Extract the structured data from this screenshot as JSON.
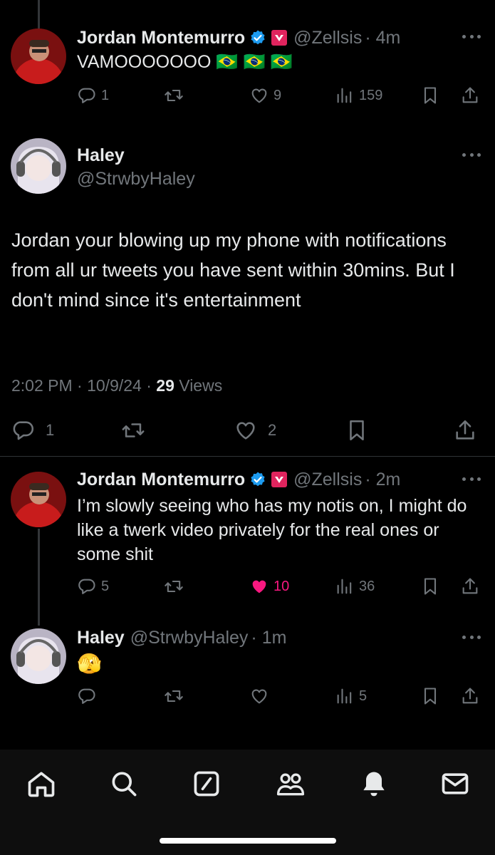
{
  "tweets": [
    {
      "name": "Jordan Montemurro",
      "handle": "@Zellsis",
      "time": "· 4m",
      "text": "VAMOOOOOOO 🇧🇷 🇧🇷 🇧🇷",
      "replies": "1",
      "retweets": "",
      "likes": "9",
      "views": "159"
    },
    {
      "name": "Jordan Montemurro",
      "handle": "@Zellsis",
      "time": "· 2m",
      "text": "I’m slowly seeing who has my notis on, I might do like a twerk video privately for the real ones or some shit",
      "replies": "5",
      "retweets": "",
      "likes": "10",
      "views": "36"
    },
    {
      "name": "Haley",
      "handle": "@StrwbyHaley",
      "time": "· 1m",
      "text": "🫣",
      "replies": "",
      "retweets": "",
      "likes": "",
      "views": "5"
    }
  ],
  "focused": {
    "name": "Haley",
    "handle": "@StrwbyHaley",
    "text": "Jordan your blowing up my phone with notifications from all ur tweets you have sent within 30mins. But I don't mind since it's entertainment",
    "time": "2:02 PM · 10/9/24 ·",
    "views_count": "29",
    "views_label": "Views",
    "replies": "1",
    "likes": "2"
  },
  "colors": {
    "background": "#000000",
    "text": "#e7e9ea",
    "muted": "#71767b",
    "like_active": "#f91880",
    "verified": "#1d9bf0",
    "badge_red": "#e0245e"
  },
  "icons": [
    "reply-icon",
    "retweet-icon",
    "like-icon",
    "views-icon",
    "bookmark-icon",
    "share-icon",
    "home-icon",
    "search-icon",
    "compose-icon",
    "communities-icon",
    "notifications-icon",
    "messages-icon"
  ]
}
